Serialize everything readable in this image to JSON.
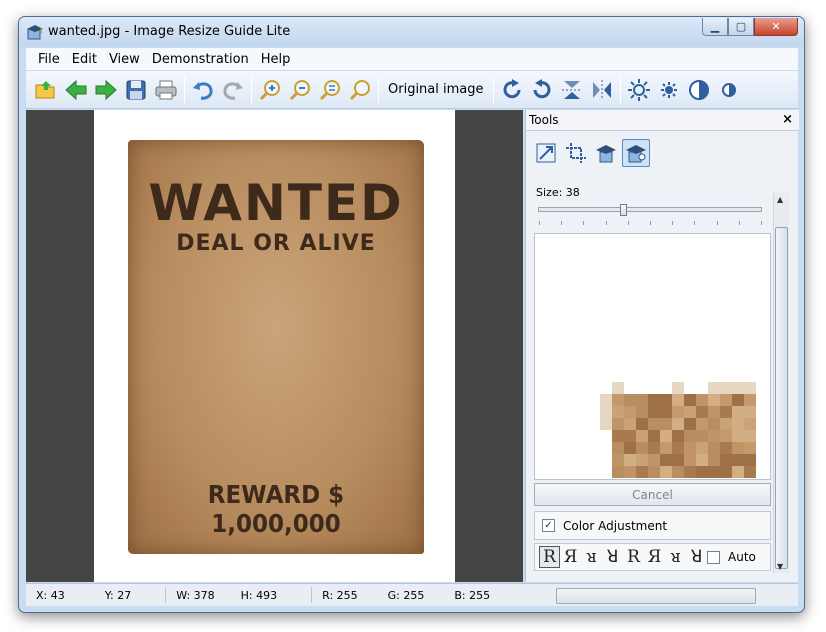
{
  "window": {
    "title": "wanted.jpg - Image Resize Guide Lite"
  },
  "window_controls": {
    "minimize": "▁",
    "restore": "▢",
    "close": "✕"
  },
  "menu": [
    "File",
    "Edit",
    "View",
    "Demonstration",
    "Help"
  ],
  "toolbar": {
    "original_image_label": "Original image"
  },
  "poster": {
    "title": "WANTED",
    "subtitle": "DEAL OR ALIVE",
    "reward": "REWARD $ 1,000,000"
  },
  "tools_panel": {
    "title": "Tools",
    "close": "×",
    "size_label": "Size: 38",
    "size_value": 38,
    "cancel_label": "Cancel",
    "color_adjustment_label": "Color Adjustment",
    "color_adjustment_checked": true,
    "check_mark": "✓",
    "auto_label": "Auto",
    "auto_checked": false,
    "glyphs": [
      "R",
      "Я",
      "ᴚ",
      "ꓤ",
      "R",
      "Я",
      "ᴚ",
      "ꓤ"
    ]
  },
  "status": {
    "x": "X: 43",
    "y": "Y: 27",
    "w": "W: 378",
    "h": "H: 493",
    "r": "R: 255",
    "g": "G: 255",
    "b": "B: 255"
  },
  "colors": {
    "accent": "#5c8ac2",
    "poster_ink": "#3e2a1b",
    "viewer_bg": "#454545"
  }
}
